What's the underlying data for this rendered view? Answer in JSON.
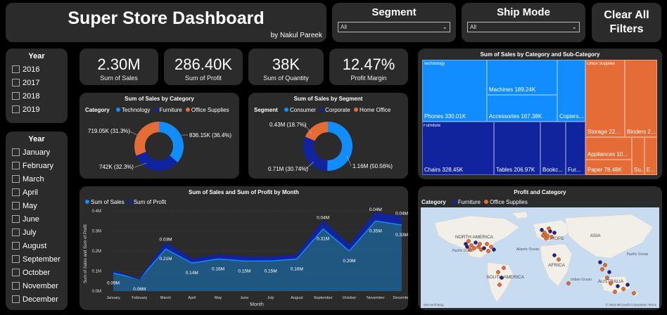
{
  "header": {
    "title": "Super Store Dashboard",
    "byline": "by Nakul Pareek"
  },
  "segment": {
    "label": "Segment",
    "value": "All"
  },
  "ship_mode": {
    "label": "Ship Mode",
    "value": "All"
  },
  "clear_filters": {
    "line1": "Clear All",
    "line2": "Filters"
  },
  "year_slicer": {
    "title": "Year",
    "items": [
      "2016",
      "2017",
      "2018",
      "2019"
    ]
  },
  "month_slicer": {
    "title": "Year",
    "items": [
      "January",
      "February",
      "March",
      "April",
      "May",
      "June",
      "July",
      "August",
      "September",
      "October",
      "November",
      "December"
    ]
  },
  "kpis": [
    {
      "value": "2.30M",
      "label": "Sum of Sales"
    },
    {
      "value": "286.40K",
      "label": "Sum of Profit"
    },
    {
      "value": "38K",
      "label": "Sum of Quantity"
    },
    {
      "value": "12.47%",
      "label": "Profit Margin"
    }
  ],
  "colors": {
    "technology": "#118dff",
    "furniture": "#12239e",
    "office_supplies": "#e66c37",
    "panel": "#2b2b2b"
  },
  "chart_data": [
    {
      "type": "pie",
      "title": "Sum of Sales by Category",
      "legend_title": "Category",
      "categories": [
        "Technology",
        "Furniture",
        "Office Supplies"
      ],
      "values": [
        836.15,
        742,
        719.05
      ],
      "labels": [
        "836.15K (36.4%)",
        "742K (32.3%)",
        "719.05K (31.3%)"
      ]
    },
    {
      "type": "pie",
      "title": "Sum of Sales by Segment",
      "legend_title": "Segment",
      "categories": [
        "Consumer",
        "Corporate",
        "Home Office"
      ],
      "values": [
        1.16,
        0.71,
        0.43
      ],
      "labels": [
        "1.16M (50.56%)",
        "0.71M (30.74%)",
        "0.43M (18.7%)"
      ]
    },
    {
      "type": "area",
      "title": "Sum of Sales and Sum of Profit by Month",
      "xlabel": "Month",
      "ylabel": "Sum of Sales and Sum of Profit",
      "ylim": [
        0,
        0.4
      ],
      "yticks": [
        "0.0M",
        "0.1M",
        "0.2M",
        "0.3M",
        "0.4M"
      ],
      "categories": [
        "January",
        "February",
        "March",
        "April",
        "May",
        "June",
        "July",
        "August",
        "September",
        "October",
        "November",
        "December"
      ],
      "series": [
        {
          "name": "Sum of Sales",
          "values": [
            0.09,
            0.06,
            0.21,
            0.14,
            0.16,
            0.15,
            0.15,
            0.16,
            0.31,
            0.2,
            0.35,
            0.33
          ],
          "labels": [
            "0.09M",
            "0.06M",
            "0.21M",
            "0.14M",
            "0.16M",
            "0.15M",
            "0.15M",
            "0.16M",
            "0.31M",
            "0.20M",
            "0.35M",
            "0.33M"
          ]
        },
        {
          "name": "Sum of Profit",
          "values": [
            0.01,
            0.0,
            0.03,
            0.02,
            0.02,
            0.02,
            0.02,
            0.02,
            0.04,
            0.03,
            0.04,
            0.04
          ],
          "labels": [
            "",
            "",
            "0.03M",
            "",
            "",
            "",
            "",
            "",
            "0.04M",
            "",
            "0.04M",
            "0.04M"
          ]
        }
      ]
    },
    {
      "type": "heatmap",
      "title": "Sum of Sales by Category and Sub-Category",
      "groups": [
        {
          "name": "Technology",
          "items": [
            {
              "label": "Phones 330.01K",
              "value": 330.01
            },
            {
              "label": "Machines 189.24K",
              "value": 189.24
            },
            {
              "label": "Accessories 167.38K",
              "value": 167.38
            },
            {
              "label": "Copiers...",
              "value": 149.53
            }
          ]
        },
        {
          "name": "Furniture",
          "items": [
            {
              "label": "Chairs 328.45K",
              "value": 328.45
            },
            {
              "label": "Tables 206.97K",
              "value": 206.97
            },
            {
              "label": "Bookc...",
              "value": 114.88
            },
            {
              "label": "Fur...",
              "value": 91.71
            }
          ]
        },
        {
          "name": "Office Supplies",
          "items": [
            {
              "label": "Storage 22...",
              "value": 223.84
            },
            {
              "label": "Binders 2...",
              "value": 203.41
            },
            {
              "label": "Appliances 10...",
              "value": 107.53
            },
            {
              "label": "Paper 78.48K",
              "value": 78.48
            },
            {
              "label": "Su...",
              "value": 46.67
            },
            {
              "label": "E...",
              "value": 12.49
            }
          ]
        }
      ]
    }
  ],
  "map": {
    "title": "Profit and Category",
    "legend_title": "Category",
    "legend": [
      "Furniture",
      "Office Supplies"
    ],
    "labels": [
      "NORTH AMERICA",
      "EUROPE",
      "ASIA",
      "AFRICA",
      "SOUTH AMERICA",
      "AUSTRALIA",
      "Pacific Ocean",
      "Atlantic Ocean",
      "Indian Ocean",
      "Pacific Ocean"
    ],
    "attribution": "© 2023 Microsoft Corporation Terms",
    "brand": "Microsoft Bing"
  }
}
